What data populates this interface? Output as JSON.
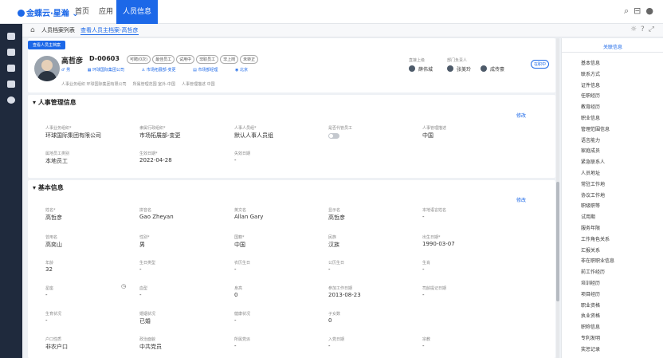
{
  "header": {
    "brand": "金蝶云·星瀚",
    "menus": [
      "首页",
      "应用",
      "人员信息"
    ]
  },
  "tabs": [
    "人员档案列表",
    "查看人员主档案-高哲彦"
  ],
  "profile": {
    "badge": "查看人员主档案",
    "name": "高哲彦",
    "id": "D-00603",
    "tags": [
      "可聘(0次)",
      "最佳员工",
      "试用中",
      "非职员工",
      "非上岗",
      "未转正"
    ],
    "gender": "男",
    "company": "环球国际集团公司",
    "dept": "市场拓展部-变更",
    "position": "市场部经理",
    "location": "北京",
    "footer": [
      "人事业务组织 环球国际集团有限公司",
      "所属管理范围 室外-中国",
      "人事管理描述 中国"
    ],
    "leader_label": "直接上级",
    "leader": "薛伟城",
    "hr_label": "部门负责人",
    "hr1": "张美玲",
    "hr2": "成传豪",
    "status": "在职中"
  },
  "sections": [
    {
      "title": "人事管理信息",
      "edit": "修改",
      "fields": [
        {
          "label": "人事业务组织*",
          "value": "环球国际集团有限公司"
        },
        {
          "label": "隶属行政组织*",
          "value": "市场拓展部-变更"
        },
        {
          "label": "人事人员组*",
          "value": "默认人事人员组"
        },
        {
          "label": "是否代管员工",
          "value": ""
        },
        {
          "label": "人事管理描述",
          "value": "中国"
        },
        {
          "label": "属地员工类别",
          "value": "本地员工"
        },
        {
          "label": "生效日期*",
          "value": "2022-04-28"
        },
        {
          "label": "失效日期",
          "value": "-"
        }
      ]
    },
    {
      "title": "基本信息",
      "edit": "修改",
      "fields": [
        {
          "label": "姓名*",
          "value": "高哲彦"
        },
        {
          "label": "拼音名",
          "value": "Gao Zheyan"
        },
        {
          "label": "英文名",
          "value": "Allan Gary"
        },
        {
          "label": "显示名",
          "value": "高哲彦"
        },
        {
          "label": "本地语言姓名",
          "value": "-"
        },
        {
          "label": "曾用名",
          "value": "高奕山"
        },
        {
          "label": "性别*",
          "value": "男"
        },
        {
          "label": "国籍*",
          "value": "中国"
        },
        {
          "label": "民族",
          "value": "汉族"
        },
        {
          "label": "出生日期*",
          "value": "1990-03-07"
        },
        {
          "label": "年龄",
          "value": "32"
        },
        {
          "label": "生日类型",
          "value": "-"
        },
        {
          "label": "农历生日",
          "value": "-"
        },
        {
          "label": "公历生日",
          "value": "-"
        },
        {
          "label": "生肖",
          "value": "-"
        },
        {
          "label": "星座",
          "value": "-"
        },
        {
          "label": "血型",
          "value": "-"
        },
        {
          "label": "身高",
          "value": "0"
        },
        {
          "label": "参加工作日期",
          "value": "2013-08-23"
        },
        {
          "label": "司龄提记日期",
          "value": "-"
        },
        {
          "label": "生育状况",
          "value": "-"
        },
        {
          "label": "婚姻状况",
          "value": "已婚"
        },
        {
          "label": "健康状况",
          "value": "-"
        },
        {
          "label": "子女数",
          "value": "0"
        },
        {
          "label": "",
          "value": ""
        },
        {
          "label": "户口性质",
          "value": "非农户口"
        },
        {
          "label": "政治面貌",
          "value": "中共党员"
        },
        {
          "label": "所属党派",
          "value": "-"
        },
        {
          "label": "入党日期",
          "value": "-"
        },
        {
          "label": "宗教",
          "value": "-"
        }
      ]
    }
  ],
  "side": {
    "title": "关联信息",
    "items": [
      "基本信息",
      "联系方式",
      "证件信息",
      "任职经历",
      "教育经历",
      "职业信息",
      "管理范围信息",
      "语言能力",
      "家庭成员",
      "紧急联系人",
      "人员地址",
      "常驻工作地",
      "协议工作地",
      "职级职等",
      "试用期",
      "服务年限",
      "工作角色关系",
      "汇报关系",
      "非在职职业信息",
      "前工作经历",
      "培训经历",
      "项目经历",
      "职业资格",
      "执业资格",
      "职称信息",
      "专利发明",
      "奖惩记录"
    ]
  }
}
